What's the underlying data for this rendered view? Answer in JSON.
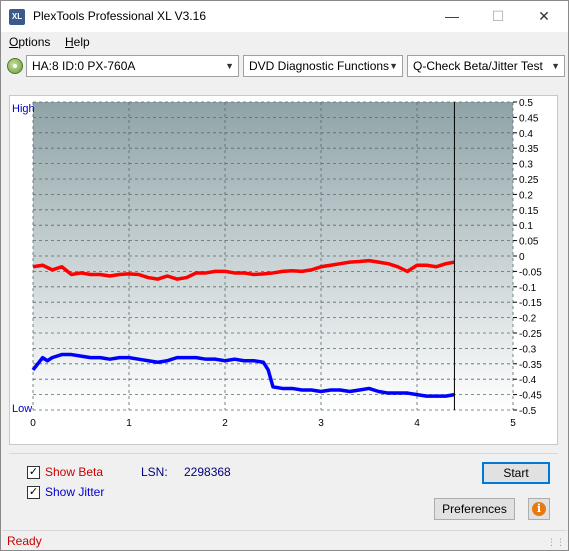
{
  "window": {
    "title": "PlexTools Professional XL V3.16",
    "icon_name": "xl-app-icon",
    "minimize_glyph": "—",
    "maximize_glyph": "☐",
    "close_glyph": "✕"
  },
  "menu": {
    "items": [
      {
        "label": "Options",
        "accel": "O",
        "rest": "ptions"
      },
      {
        "label": "Help",
        "accel": "H",
        "rest": "elp"
      }
    ]
  },
  "toolbar": {
    "drive": "HA:8 ID:0  PX-760A",
    "function": "DVD Diagnostic Functions",
    "test": "Q-Check Beta/Jitter Test"
  },
  "chart": {
    "left_label_high": "High",
    "left_label_low": "Low"
  },
  "chart_data": {
    "type": "line",
    "x_ticks": [
      "0",
      "1",
      "2",
      "3",
      "4",
      "5"
    ],
    "xlim": [
      0,
      5
    ],
    "y_right_ticks": [
      "0.5",
      "0.45",
      "0.4",
      "0.35",
      "0.3",
      "0.25",
      "0.2",
      "0.15",
      "0.1",
      "0.05",
      "0",
      "-0.05",
      "-0.1",
      "-0.15",
      "-0.2",
      "-0.25",
      "-0.3",
      "-0.35",
      "-0.4",
      "-0.45",
      "-0.5"
    ],
    "ylim": [
      -0.5,
      0.5
    ],
    "end_marker_x": 4.39,
    "grid": true,
    "background_gradient": [
      "#8fa3a7",
      "#ffffff"
    ],
    "series": [
      {
        "color": "#ff0000",
        "x": [
          0.0,
          0.1,
          0.2,
          0.3,
          0.4,
          0.5,
          0.6,
          0.7,
          0.8,
          0.9,
          1.0,
          1.1,
          1.2,
          1.3,
          1.4,
          1.5,
          1.6,
          1.7,
          1.8,
          1.9,
          2.0,
          2.1,
          2.2,
          2.3,
          2.4,
          2.5,
          2.6,
          2.7,
          2.8,
          2.9,
          3.0,
          3.1,
          3.2,
          3.3,
          3.4,
          3.5,
          3.6,
          3.7,
          3.8,
          3.9,
          4.0,
          4.1,
          4.2,
          4.3,
          4.39
        ],
        "y": [
          -0.035,
          -0.03,
          -0.045,
          -0.035,
          -0.06,
          -0.055,
          -0.06,
          -0.06,
          -0.065,
          -0.06,
          -0.058,
          -0.06,
          -0.07,
          -0.075,
          -0.065,
          -0.075,
          -0.07,
          -0.055,
          -0.055,
          -0.05,
          -0.05,
          -0.055,
          -0.055,
          -0.06,
          -0.058,
          -0.055,
          -0.05,
          -0.048,
          -0.05,
          -0.045,
          -0.035,
          -0.03,
          -0.025,
          -0.02,
          -0.018,
          -0.015,
          -0.02,
          -0.025,
          -0.035,
          -0.05,
          -0.03,
          -0.03,
          -0.035,
          -0.025,
          -0.02
        ]
      },
      {
        "color": "#0000ff",
        "x": [
          0.0,
          0.05,
          0.1,
          0.15,
          0.2,
          0.3,
          0.4,
          0.5,
          0.6,
          0.7,
          0.8,
          0.9,
          1.0,
          1.1,
          1.2,
          1.3,
          1.4,
          1.5,
          1.6,
          1.7,
          1.8,
          1.9,
          2.0,
          2.1,
          2.2,
          2.3,
          2.4,
          2.45,
          2.5,
          2.6,
          2.7,
          2.8,
          2.9,
          3.0,
          3.1,
          3.2,
          3.3,
          3.4,
          3.5,
          3.6,
          3.7,
          3.8,
          3.9,
          4.0,
          4.1,
          4.2,
          4.3,
          4.39
        ],
        "y": [
          -0.37,
          -0.35,
          -0.33,
          -0.34,
          -0.33,
          -0.32,
          -0.32,
          -0.325,
          -0.33,
          -0.33,
          -0.335,
          -0.33,
          -0.33,
          -0.335,
          -0.34,
          -0.345,
          -0.34,
          -0.33,
          -0.33,
          -0.33,
          -0.335,
          -0.335,
          -0.34,
          -0.335,
          -0.34,
          -0.34,
          -0.345,
          -0.37,
          -0.425,
          -0.43,
          -0.43,
          -0.435,
          -0.435,
          -0.44,
          -0.435,
          -0.435,
          -0.44,
          -0.435,
          -0.43,
          -0.44,
          -0.445,
          -0.445,
          -0.445,
          -0.45,
          -0.455,
          -0.455,
          -0.455,
          -0.45
        ]
      }
    ]
  },
  "bottom": {
    "show_beta_label": "Show Beta",
    "show_beta_accel": "B",
    "show_jitter_label": "Show Jitter",
    "show_jitter_accel": "J",
    "show_beta_checked": true,
    "show_jitter_checked": true,
    "lsn_label": "LSN:",
    "lsn_value": "2298368",
    "start_label": "Start",
    "preferences_label": "Preferences",
    "info_glyph": "i"
  },
  "status": {
    "text": "Ready"
  }
}
